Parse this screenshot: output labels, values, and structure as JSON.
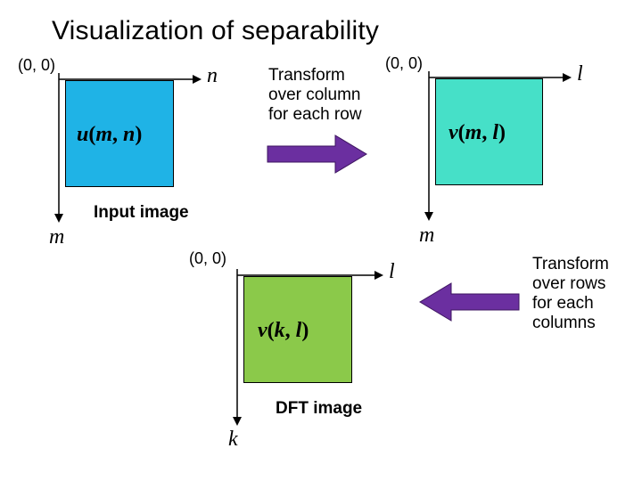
{
  "title": "Visualization of separability",
  "origin": "(0, 0)",
  "square1": {
    "matrix": "u(m, n)",
    "x_axis": "n",
    "y_axis": "m",
    "caption": "Input image",
    "fill": "#1fb3e6"
  },
  "step1": {
    "text1": "Transform",
    "text2": "over column",
    "text3": "for each row"
  },
  "square2": {
    "matrix": "v(m, l)",
    "x_axis": "l",
    "y_axis": "m",
    "fill": "#46e0c8"
  },
  "step2": {
    "text1": "Transform",
    "text2": "over rows",
    "text3": "for each",
    "text4": "columns"
  },
  "square3": {
    "matrix": "v(k, l)",
    "x_axis": "l",
    "y_axis": "k",
    "caption": "DFT image",
    "fill": "#8bc94a"
  }
}
